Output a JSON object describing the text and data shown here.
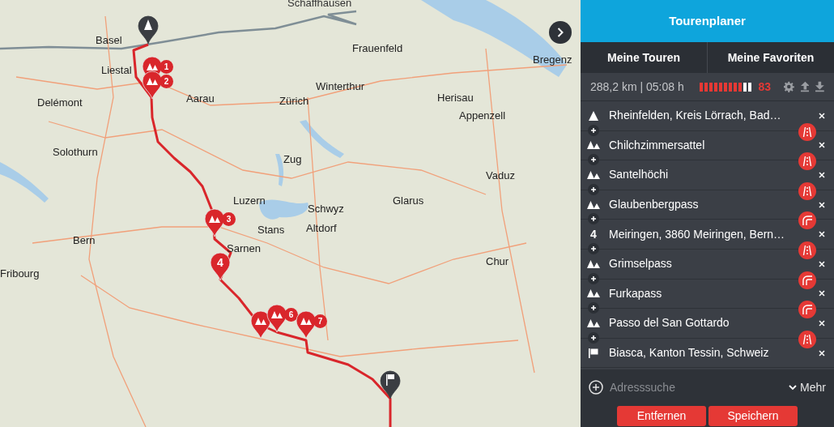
{
  "map": {
    "labels": [
      "Schaffhausen",
      "Basel",
      "Frauenfeld",
      "Liestal",
      "Winterthur",
      "Bregenz",
      "Delémont",
      "Aarau",
      "Zürich",
      "Herisau",
      "Appenzell",
      "Solothurn",
      "Zug",
      "Vaduz",
      "Luzern",
      "Glarus",
      "Schwyz",
      "Stans",
      "Bern",
      "Sarnen",
      "Altdorf",
      "Chur",
      "Fribourg"
    ],
    "markers": [
      {
        "kind": "start"
      },
      {
        "kind": "pass",
        "badge": "1"
      },
      {
        "kind": "pass",
        "badge": "2"
      },
      {
        "kind": "pass",
        "badge": "3"
      },
      {
        "kind": "waypoint",
        "number": "4"
      },
      {
        "kind": "pass"
      },
      {
        "kind": "pass",
        "badge": "6"
      },
      {
        "kind": "pass",
        "badge": "7"
      },
      {
        "kind": "finish"
      }
    ]
  },
  "panel": {
    "title": "Tourenplaner",
    "tabs": [
      "Meine Touren",
      "Meine Favoriten"
    ],
    "stats": "288,2 km | 05:08 h",
    "rating": {
      "level": 0.818,
      "score": "83"
    },
    "waypoints": [
      {
        "kind": "start",
        "label": "Rheinfelden, Kreis Lörrach, Bad…",
        "segment": {
          "kind": "straight"
        }
      },
      {
        "kind": "pass",
        "label": "Chilchzimmersattel",
        "segment": {
          "kind": "straight"
        }
      },
      {
        "kind": "pass",
        "label": "Santelhöchi",
        "segment": {
          "kind": "straight"
        }
      },
      {
        "kind": "pass",
        "label": "Glaubenbergpass",
        "segment": {
          "kind": "curvy"
        }
      },
      {
        "kind": "waypoint",
        "number": "4",
        "label": "Meiringen, 3860 Meiringen, Bern…",
        "segment": {
          "kind": "straight"
        }
      },
      {
        "kind": "pass",
        "label": "Grimselpass",
        "segment": {
          "kind": "curvy"
        }
      },
      {
        "kind": "pass",
        "label": "Furkapass",
        "segment": {
          "kind": "curvy"
        }
      },
      {
        "kind": "pass",
        "label": "Passo del San Gottardo",
        "segment": {
          "kind": "straight"
        }
      },
      {
        "kind": "finish",
        "label": "Biasca, Kanton Tessin, Schweiz"
      }
    ],
    "search": {
      "placeholder": "Adresssuche"
    },
    "more": "Mehr",
    "buttons": [
      "Entfernen",
      "Speichern"
    ]
  }
}
